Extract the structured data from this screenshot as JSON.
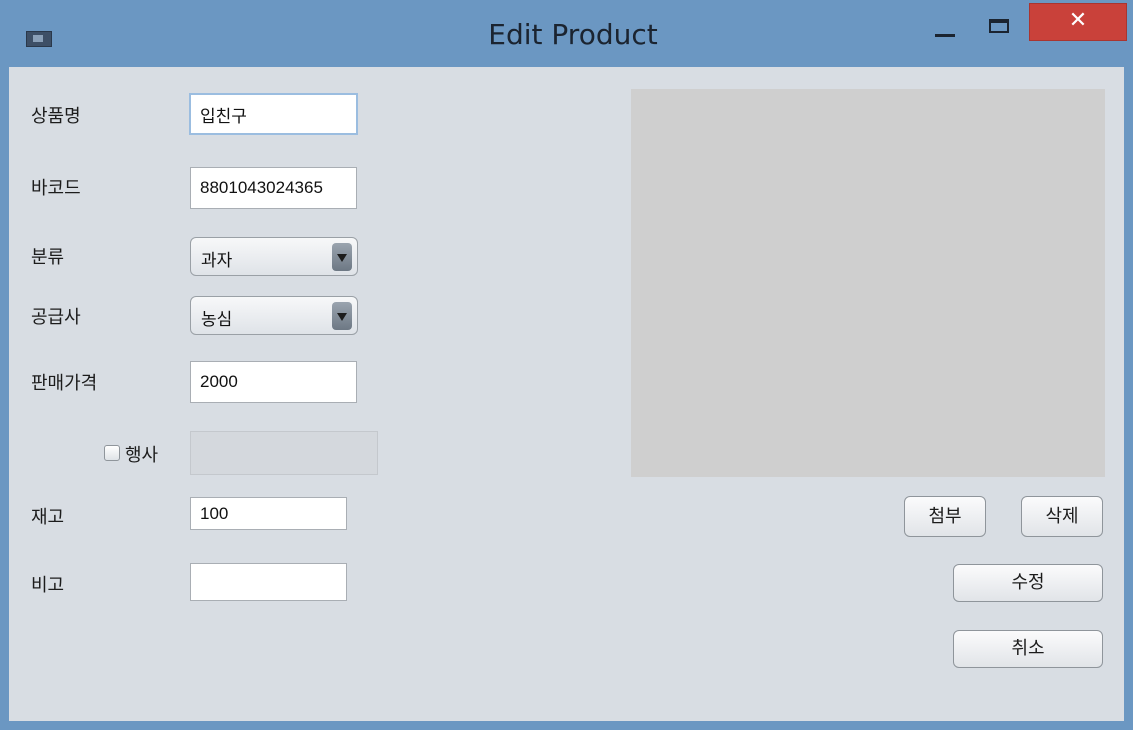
{
  "window": {
    "title": "Edit Product",
    "close_glyph": "✕"
  },
  "form": {
    "name_label": "상품명",
    "name_value": "입친구",
    "barcode_label": "바코드",
    "barcode_value": "8801043024365",
    "category_label": "분류",
    "category_value": "과자",
    "supplier_label": "공급사",
    "supplier_value": "농심",
    "price_label": "판매가격",
    "price_value": "2000",
    "event_label": "행사",
    "event_checked": false,
    "event_value": "",
    "stock_label": "재고",
    "stock_value": "100",
    "note_label": "비고",
    "note_value": ""
  },
  "buttons": {
    "attach": "첨부",
    "delete": "삭제",
    "edit": "수정",
    "cancel": "취소"
  },
  "colors": {
    "title_bar": "#6b97c2",
    "close_button": "#c9413a",
    "panel": "#d8dde3",
    "image_placeholder": "#cfcfcf"
  }
}
